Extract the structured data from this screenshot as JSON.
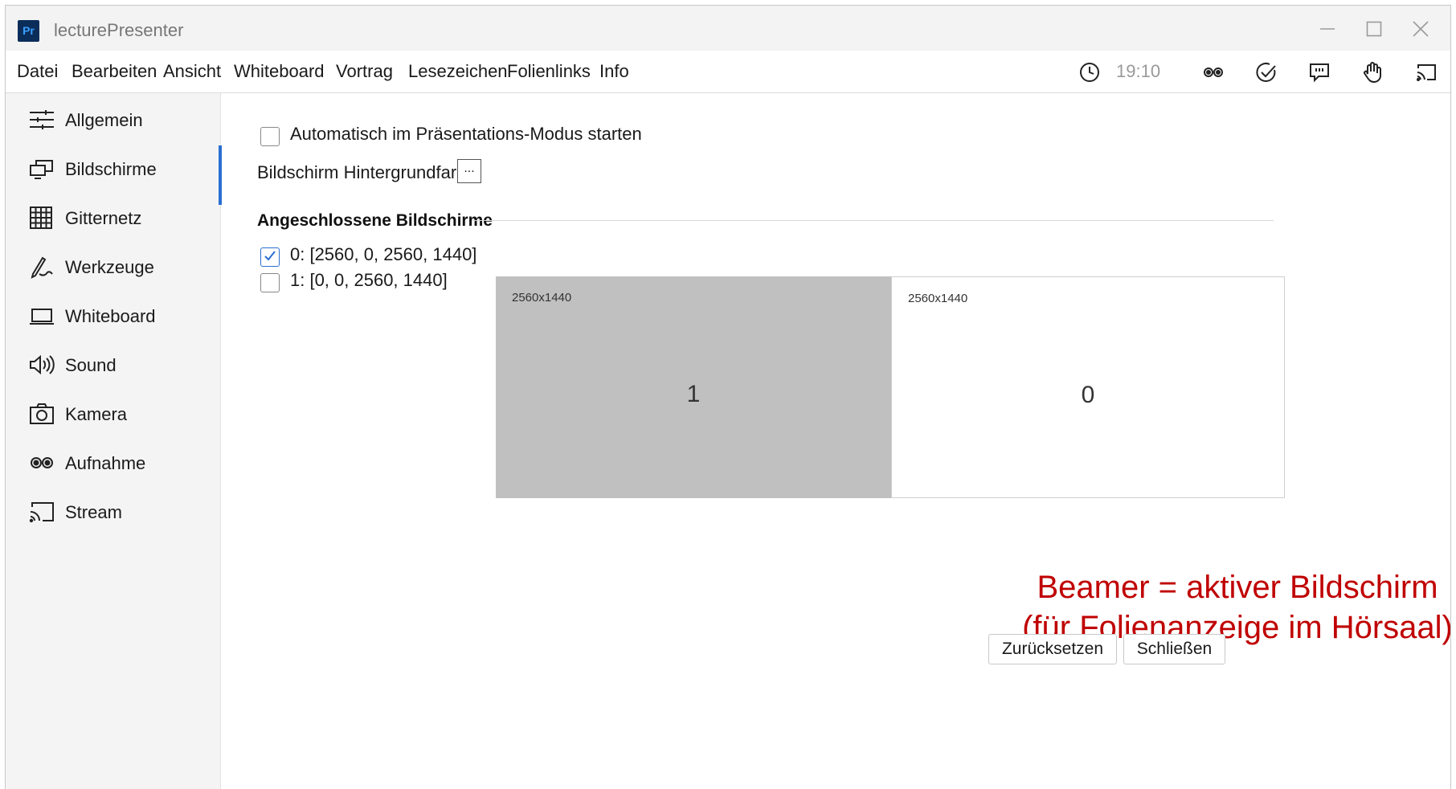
{
  "window": {
    "app_icon_text": "Pr",
    "title": "lecturePresenter"
  },
  "menu": {
    "items": [
      "Datei",
      "Bearbeiten",
      "Ansicht",
      "Whiteboard",
      "Vortrag",
      "Lesezeichen",
      "Folienlinks",
      "Info"
    ]
  },
  "toolbar": {
    "time": "19:10",
    "icons": [
      "clock-icon",
      "recording-icon",
      "check-icon",
      "chat-icon",
      "hand-icon",
      "stream-icon"
    ]
  },
  "sidebar": {
    "items": [
      {
        "label": "Allgemein",
        "icon": "sliders-icon"
      },
      {
        "label": "Bildschirme",
        "icon": "monitors-icon",
        "active": true
      },
      {
        "label": "Gitternetz",
        "icon": "grid-icon"
      },
      {
        "label": "Werkzeuge",
        "icon": "pen-icon"
      },
      {
        "label": "Whiteboard",
        "icon": "laptop-icon"
      },
      {
        "label": "Sound",
        "icon": "speaker-icon"
      },
      {
        "label": "Kamera",
        "icon": "camera-icon"
      },
      {
        "label": "Aufnahme",
        "icon": "recording-icon"
      },
      {
        "label": "Stream",
        "icon": "cast-icon"
      }
    ]
  },
  "settings": {
    "auto_start_label": "Automatisch im Präsentations-Modus starten",
    "auto_start_checked": false,
    "bg_color_label": "Bildschirm Hintergrundfarbe",
    "bg_color_button": "...",
    "section_title": "Angeschlossene Bildschirme",
    "screens": [
      {
        "label": "0: [2560, 0, 2560, 1440]",
        "checked": true
      },
      {
        "label": "1: [0, 0, 2560, 1440]",
        "checked": false
      }
    ]
  },
  "preview": {
    "screen_left": {
      "resolution": "2560x1440",
      "number": "1"
    },
    "screen_right": {
      "resolution": "2560x1440",
      "number": "0"
    }
  },
  "annotation": {
    "line1": "Beamer = aktiver Bildschirm",
    "line2": "(für Folienanzeige im Hörsaal)"
  },
  "buttons": {
    "reset": "Zurücksetzen",
    "close": "Schließen"
  }
}
